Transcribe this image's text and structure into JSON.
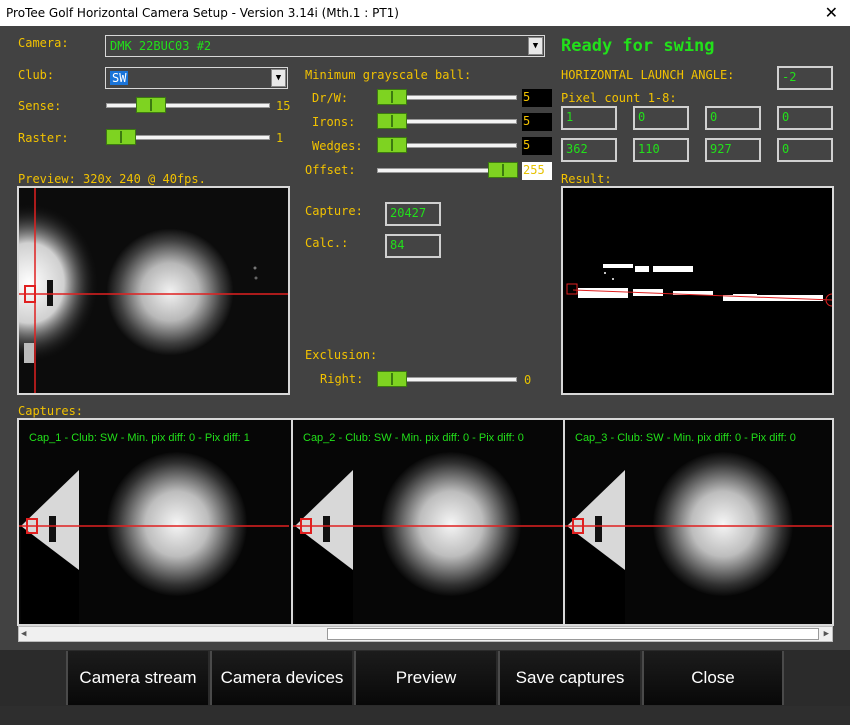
{
  "window": {
    "title": "ProTee Golf Horizontal Camera Setup - Version 3.14i (Mth.1 : PT1)",
    "close_glyph": "✕"
  },
  "camera": {
    "label": "Camera:",
    "value": "DMK 22BUC03 #2"
  },
  "status": "Ready for swing",
  "club": {
    "label": "Club:",
    "value": "SW"
  },
  "sense": {
    "label": "Sense:",
    "value": "15"
  },
  "raster": {
    "label": "Raster:",
    "value": "1"
  },
  "min_gray": {
    "title": "Minimum grayscale ball:",
    "drw": {
      "label": "Dr/W:",
      "value": "5"
    },
    "irons": {
      "label": "Irons:",
      "value": "5"
    },
    "wedges": {
      "label": "Wedges:",
      "value": "5"
    },
    "offset": {
      "label": "Offset:",
      "value": "255"
    }
  },
  "launch_angle": {
    "label": "HORIZONTAL LAUNCH ANGLE:",
    "value": "-2"
  },
  "pixel_count": {
    "label": "Pixel count 1-8:",
    "values": [
      "1",
      "0",
      "0",
      "0",
      "362",
      "110",
      "927",
      "0"
    ]
  },
  "preview": {
    "label": "Preview: 320x 240 @ 40fps."
  },
  "result": {
    "label": "Result:"
  },
  "capture": {
    "label": "Capture:",
    "value": "20427"
  },
  "calc": {
    "label": "Calc.:",
    "value": "84"
  },
  "exclusion": {
    "title": "Exclusion:",
    "right_label": "Right:",
    "right_value": "0"
  },
  "captures": {
    "label": "Captures:",
    "items": [
      "Cap_1 - Club: SW - Min. pix diff: 0 - Pix diff: 1",
      "Cap_2 - Club: SW - Min. pix diff: 0 - Pix diff: 0",
      "Cap_3 - Club: SW - Min. pix diff: 0 - Pix diff: 0"
    ]
  },
  "buttons": {
    "camera_stream": "Camera stream",
    "camera_devices": "Camera devices",
    "preview": "Preview",
    "save_captures": "Save captures",
    "close": "Close"
  },
  "colors": {
    "label": "#f2c200",
    "value_green": "#22e01a",
    "background": "#424242",
    "crosshair": "#e02020"
  }
}
